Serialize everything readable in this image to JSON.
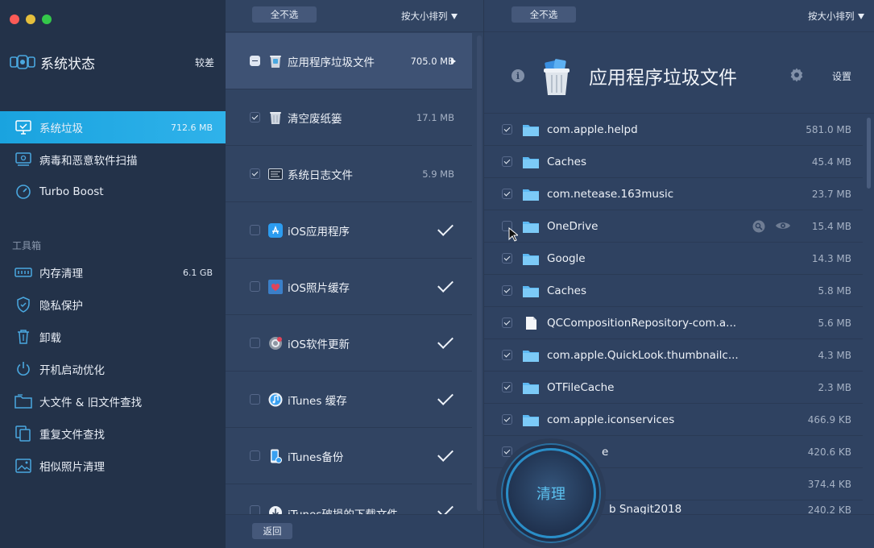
{
  "sidebar": {
    "status": {
      "title": "系统状态",
      "value": "较差"
    },
    "active": {
      "label": "系统垃圾",
      "size": "712.6 MB"
    },
    "items_top": [
      {
        "label": "病毒和恶意软件扫描"
      },
      {
        "label": "Turbo Boost"
      }
    ],
    "toolbox_label": "工具箱",
    "tools": [
      {
        "label": "内存清理",
        "size": "6.1 GB"
      },
      {
        "label": "隐私保护"
      },
      {
        "label": "卸载"
      },
      {
        "label": "开机启动优化"
      },
      {
        "label": "大文件 & 旧文件查找"
      },
      {
        "label": "重复文件查找"
      },
      {
        "label": "相似照片清理"
      }
    ]
  },
  "middle": {
    "deselect_all": "全不选",
    "sort_label": "按大小排列",
    "categories": [
      {
        "label": "应用程序垃圾文件",
        "size": "705.0 MB"
      },
      {
        "label": "清空废纸篓",
        "size": "17.1 MB"
      },
      {
        "label": "系统日志文件",
        "size": "5.9 MB"
      },
      {
        "label": "iOS应用程序"
      },
      {
        "label": "iOS照片缓存"
      },
      {
        "label": "iOS软件更新"
      },
      {
        "label": "iTunes 缓存"
      },
      {
        "label": "iTunes备份"
      },
      {
        "label": "iTunes破损的下载文件"
      }
    ],
    "back_label": "返回"
  },
  "right": {
    "deselect_all": "全不选",
    "sort_label": "按大小排列",
    "title": "应用程序垃圾文件",
    "settings_label": "设置",
    "files": [
      {
        "name": "com.apple.helpd",
        "size": "581.0 MB",
        "type": "folder"
      },
      {
        "name": "Caches",
        "size": "45.4 MB",
        "type": "folder"
      },
      {
        "name": "com.netease.163music",
        "size": "23.7 MB",
        "type": "folder"
      },
      {
        "name": "OneDrive",
        "size": "15.4 MB",
        "type": "folder"
      },
      {
        "name": "Google",
        "size": "14.3 MB",
        "type": "folder"
      },
      {
        "name": "Caches",
        "size": "5.8 MB",
        "type": "folder"
      },
      {
        "name": "QCCompositionRepository-com.a...",
        "size": "5.6 MB",
        "type": "file"
      },
      {
        "name": "com.apple.QuickLook.thumbnailc...",
        "size": "4.3 MB",
        "type": "folder"
      },
      {
        "name": "OTFileCache",
        "size": "2.3 MB",
        "type": "folder"
      },
      {
        "name": "com.apple.iconservices",
        "size": "466.9 KB",
        "type": "folder"
      },
      {
        "name": "e",
        "size": "420.6 KB",
        "type": "folder"
      },
      {
        "name": "",
        "size": "374.4 KB",
        "type": "folder"
      },
      {
        "name": "b Snagit2018",
        "size": "240.2 KB",
        "type": "folder"
      }
    ],
    "clean_label": "清理"
  },
  "colors": {
    "accent": "#1aa3df",
    "sidebar_bg": "#233249",
    "panel_bg": "#314462",
    "clean_text": "#5cc2f0"
  }
}
